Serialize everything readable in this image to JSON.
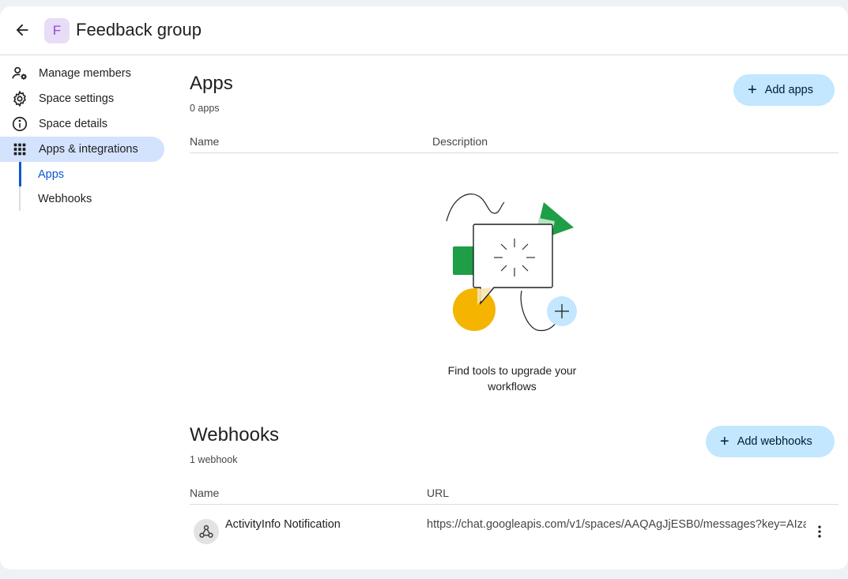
{
  "header": {
    "avatar_letter": "F",
    "title": "Feedback group"
  },
  "sidebar": {
    "items": [
      {
        "label": "Manage members",
        "icon": "manage-members-icon"
      },
      {
        "label": "Space settings",
        "icon": "gear-icon"
      },
      {
        "label": "Space details",
        "icon": "info-icon"
      },
      {
        "label": "Apps & integrations",
        "icon": "apps-grid-icon"
      }
    ],
    "sub_items": [
      {
        "label": "Apps"
      },
      {
        "label": "Webhooks"
      }
    ]
  },
  "apps": {
    "title": "Apps",
    "count": "0 apps",
    "add_label": "Add apps",
    "columns": [
      "Name",
      "Description"
    ],
    "empty_text": "Find tools to upgrade your workflows"
  },
  "webhooks": {
    "title": "Webhooks",
    "count": "1 webhook",
    "add_label": "Add webhooks",
    "columns": [
      "Name",
      "URL"
    ],
    "rows": [
      {
        "name": "ActivityInfo Notification",
        "url": "https://chat.googleapis.com/v1/spaces/AAQAgJjESB0/messages?key=AIza..."
      }
    ]
  },
  "colors": {
    "active_nav_bg": "#d3e3fd",
    "accent": "#0b57d0",
    "button_bg": "#c2e7ff",
    "avatar_bg": "#e8dcf7"
  }
}
